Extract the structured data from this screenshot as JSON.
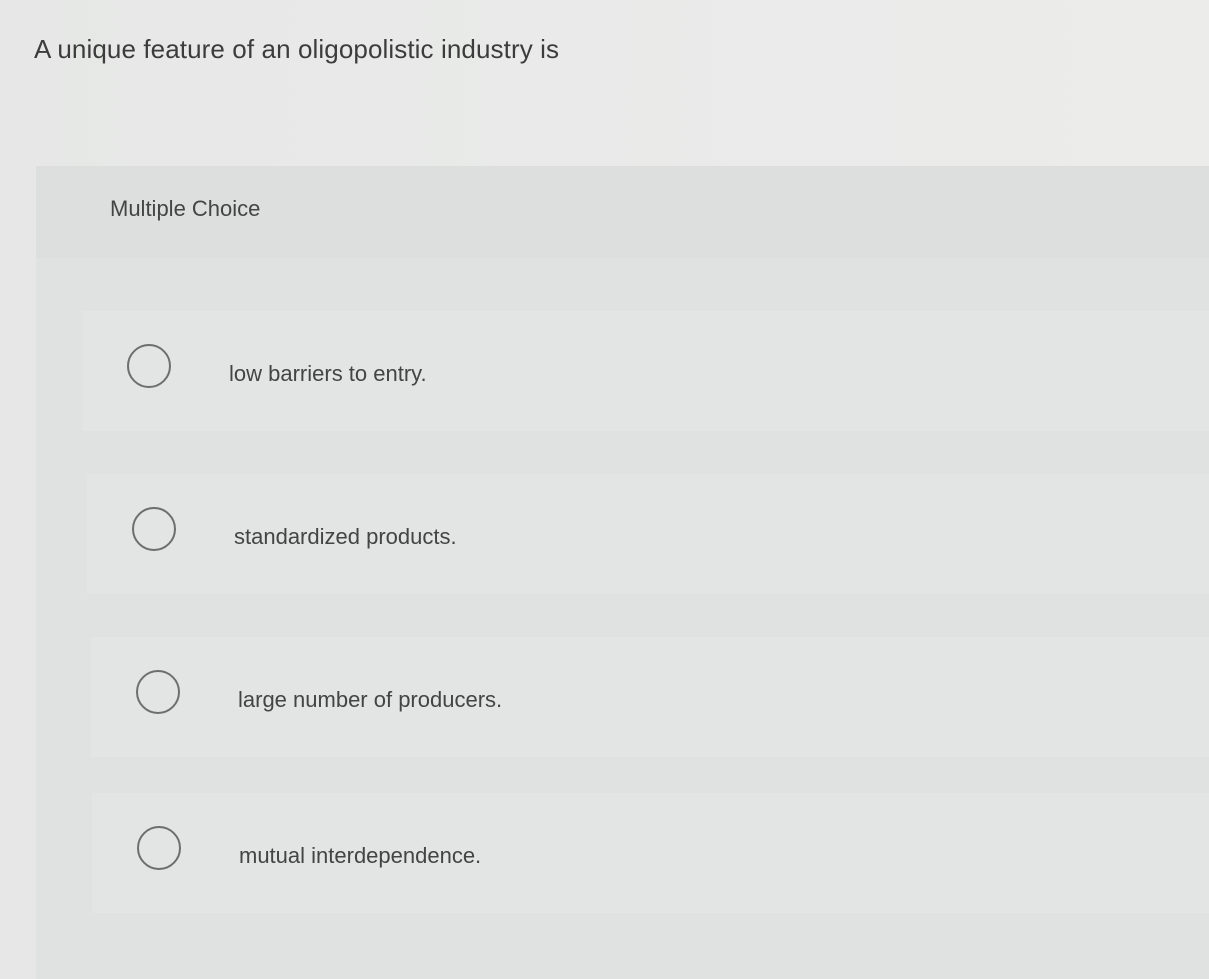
{
  "question": {
    "text": "A unique feature of an oligopolistic industry is"
  },
  "panel": {
    "title": "Multiple Choice"
  },
  "options": [
    {
      "label": "low barriers to entry."
    },
    {
      "label": "standardized products."
    },
    {
      "label": "large number of producers."
    },
    {
      "label": "mutual interdependence."
    }
  ]
}
